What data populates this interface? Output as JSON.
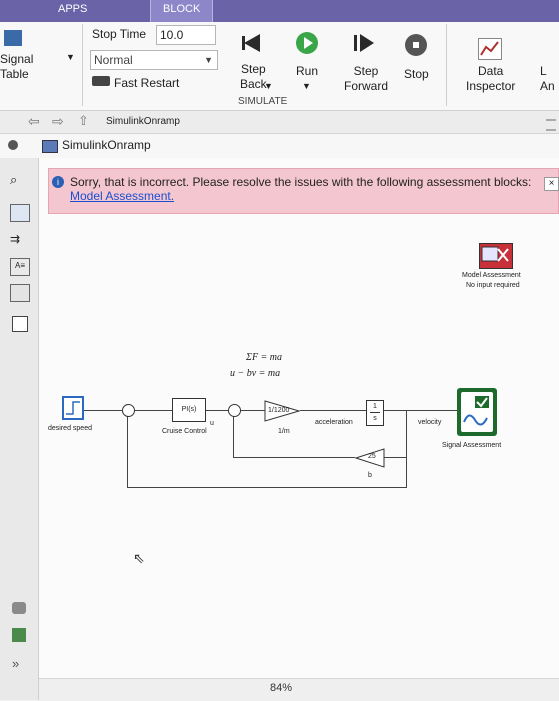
{
  "tabs": {
    "apps": "APPS",
    "block": "BLOCK"
  },
  "toolstrip": {
    "signal_table": "Signal\nTable",
    "stop_time_label": "Stop Time",
    "stop_time_value": "10.0",
    "sim_mode": "Normal",
    "fast_restart": "Fast Restart",
    "step_back": "Step\nBack",
    "run": "Run",
    "step_forward": "Step\nForward",
    "stop": "Stop",
    "data_inspector": "Data\nInspector",
    "cut_letter": "L\nAn",
    "section_label": "SIMULATE"
  },
  "breadcrumb": {
    "item": "SimulinkOnramp"
  },
  "address": {
    "model": "SimulinkOnramp"
  },
  "banner": {
    "text": "Sorry, that is incorrect. Please resolve the issues with the following assessment blocks:",
    "link": "Model Assessment.",
    "close": "×"
  },
  "diagram": {
    "eq1": "ΣF = ma",
    "eq2": "u − bv = ma",
    "desired_speed": "desired speed",
    "pi_block": "PI(s)",
    "cruise_control": "Cruise Control",
    "u_label": "u",
    "gain_block": "1/1200",
    "gain_label": "1/m",
    "acceleration": "acceleration",
    "integrator_top": "1",
    "integrator_bottom": "s",
    "velocity": "velocity",
    "feedback_gain": "25",
    "b_label": "b",
    "model_assessment": "Model Assessment",
    "no_input": "No input required",
    "signal_assessment": "Signal Assessment"
  },
  "status": {
    "zoom": "84%"
  },
  "palette": {
    "expand": "»"
  },
  "colors": {
    "ribbon": "#6a63a8",
    "banner": "#f4c6cf",
    "link": "#1a4fd1",
    "run_green": "#3aa649",
    "scope_green": "#1d6b2c"
  }
}
